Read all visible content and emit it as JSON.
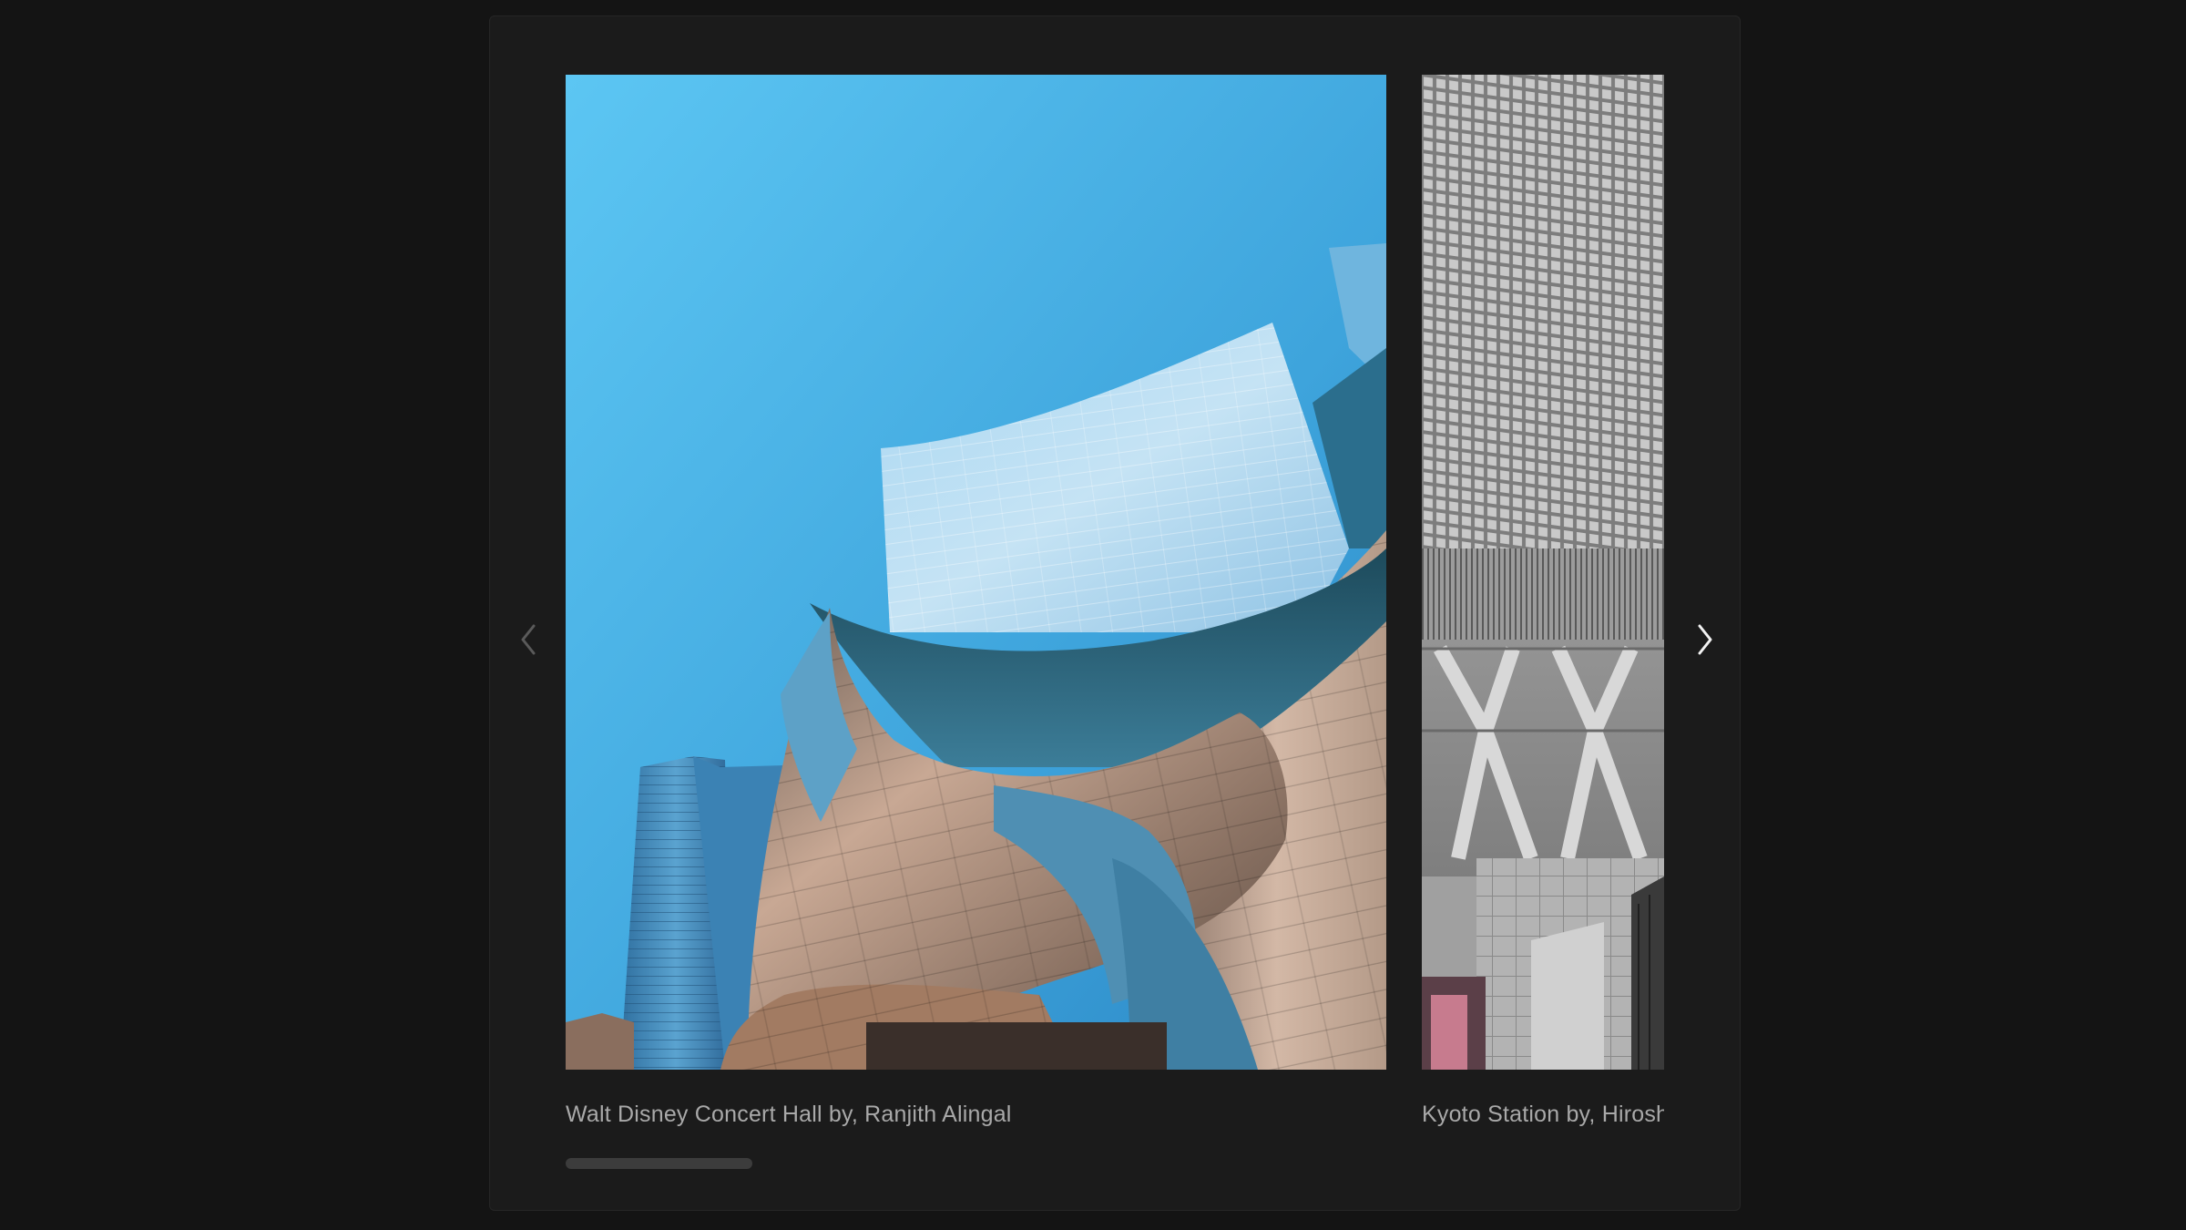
{
  "carousel": {
    "slides": [
      {
        "caption": "Walt Disney Concert Hall by, Ranjith Alingal",
        "image": "walt-disney-concert-hall-photo"
      },
      {
        "caption": "Kyoto Station by, Hiroshi Tsubono",
        "image": "kyoto-station-photo"
      }
    ],
    "prev_icon": "chevron-left-icon",
    "next_icon": "chevron-right-icon",
    "progress": 0.17,
    "colors": {
      "background": "#141414",
      "panel": "#1b1b1b",
      "caption": "#a9a9a9",
      "progress_bar": "#3c3c3c",
      "nav_next": "#f2f2f2",
      "nav_prev_disabled": "#5a5a5a"
    }
  }
}
